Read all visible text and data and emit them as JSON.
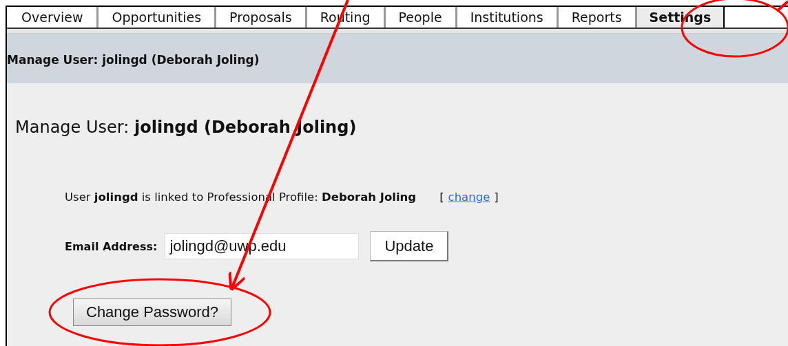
{
  "tabs": [
    {
      "label": "Overview",
      "selected": false
    },
    {
      "label": "Opportunities",
      "selected": false
    },
    {
      "label": "Proposals",
      "selected": false
    },
    {
      "label": "Routing",
      "selected": false
    },
    {
      "label": "People",
      "selected": false
    },
    {
      "label": "Institutions",
      "selected": false
    },
    {
      "label": "Reports",
      "selected": false
    },
    {
      "label": "Settings",
      "selected": true
    }
  ],
  "header": {
    "title": "Manage User: jolingd (Deborah Joling)"
  },
  "heading": "Manage User: **jolingd (Deborah Joling)**",
  "profile": {
    "text": "User **jolingd** is linked to Professional Profile: **Deborah Joling**",
    "bracket_open": "[",
    "link": "change",
    "bracket_close": "]"
  },
  "email": {
    "label": "Email Address:",
    "value": "jolingd@uwp.edu",
    "button": "Update"
  },
  "change_password_button": "Change Password?"
}
